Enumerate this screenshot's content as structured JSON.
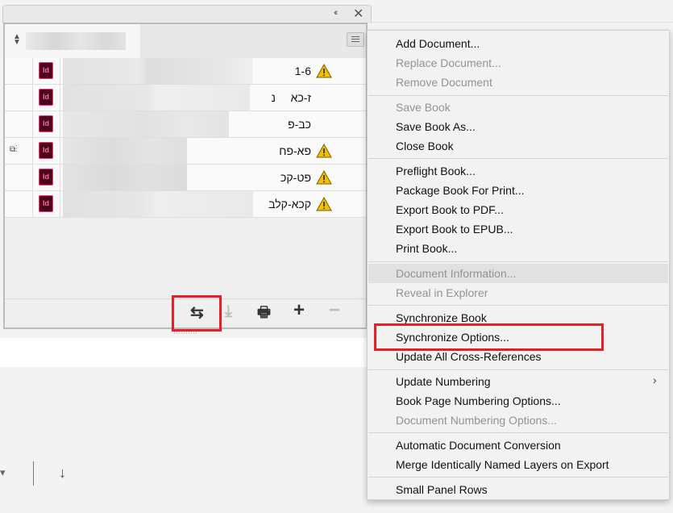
{
  "panel": {
    "collapse_glyph": "‹‹",
    "close_glyph": "✕",
    "rows": [
      {
        "name": "1-6",
        "warning": true,
        "linked": false
      },
      {
        "name": "ז-כא",
        "extra": "נ",
        "warning": false,
        "linked": false
      },
      {
        "name": "כב-פ",
        "warning": false,
        "linked": false
      },
      {
        "name": "פא-פח",
        "warning": true,
        "linked": true
      },
      {
        "name": "פט-קכ",
        "warning": true,
        "linked": false
      },
      {
        "name": "קכא-קלב",
        "warning": true,
        "linked": false
      }
    ],
    "id_label": "Id",
    "toolbar": {
      "sync_glyph": "⇆",
      "save_glyph": "⤓",
      "print_glyph": "🖶",
      "add_glyph": "+",
      "remove_glyph": "−"
    }
  },
  "menu": {
    "group1": [
      "Add Document...",
      "Replace Document...",
      "Remove Document"
    ],
    "group2": [
      "Save Book",
      "Save Book As...",
      "Close Book"
    ],
    "group3": [
      "Preflight Book...",
      "Package Book For Print...",
      "Export Book to PDF...",
      "Export Book to EPUB...",
      "Print Book..."
    ],
    "group4": [
      "Document Information...",
      "Reveal in Explorer"
    ],
    "group5": [
      "Synchronize Book",
      "Synchronize Options...",
      "Update All Cross-References"
    ],
    "group6": [
      "Update Numbering",
      "Book Page Numbering Options...",
      "Document Numbering Options..."
    ],
    "group7": [
      "Automatic Document Conversion",
      "Merge Identically Named Layers on Export"
    ],
    "group8": [
      "Small Panel Rows"
    ],
    "submenu_glyph": "›"
  },
  "background": {
    "down_arrow": "↓"
  },
  "colors": {
    "accent_red": "#e3202a",
    "indesign_dark": "#49021f",
    "indesign_pink": "#ff3366"
  }
}
